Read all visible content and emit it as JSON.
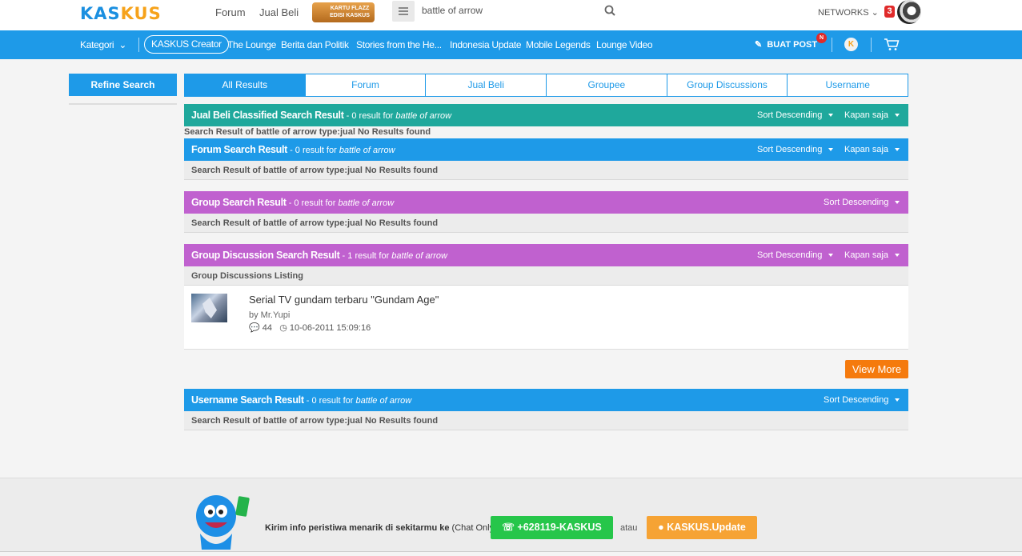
{
  "header": {
    "logo_part1": "KAS",
    "logo_part2": "KUS",
    "links": [
      "Forum",
      "Jual Beli"
    ],
    "promo_text": "KARTU FLAZZ EDISI KASKUS",
    "search_value": "battle of arrow",
    "networks_label": "NETWORKS",
    "notification_count": "3"
  },
  "navbar": {
    "kategori": "Kategori",
    "creator": "KASKUS Creator",
    "items": [
      "The Lounge",
      "Berita dan Politik",
      "Stories from the He...",
      "Indonesia Update",
      "Mobile Legends",
      "Lounge Video"
    ],
    "buat_post": "BUAT POST",
    "new_badge": "N"
  },
  "sidebar": {
    "refine_label": "Refine Search"
  },
  "tabs": [
    "All Results",
    "Forum",
    "Jual Beli",
    "Groupee",
    "Group Discussions",
    "Username"
  ],
  "sort_label": "Sort Descending",
  "time_label": "Kapan saja",
  "sections": {
    "jual_beli": {
      "title": "Jual Beli Classified Search Result",
      "count": " - 0 result for ",
      "query": "battle of arrow",
      "note": "Search Result of battle of arrow type:jual No Results found"
    },
    "forum": {
      "title": "Forum Search Result",
      "count": " - 0 result for ",
      "query": "battle of arrow",
      "note": "Search Result of battle of arrow type:jual No Results found"
    },
    "group": {
      "title": "Group Search Result",
      "count": " - 0 result for ",
      "query": "battle of arrow",
      "note": "Search Result of battle of arrow type:jual No Results found"
    },
    "group_discussion": {
      "title": "Group Discussion Search Result",
      "count": " - 1 result for ",
      "query": "battle of arrow",
      "listing": "Group Discussions Listing"
    },
    "username": {
      "title": "Username Search Result",
      "count": " - 0 result for ",
      "query": "battle of arrow",
      "note": "Search Result of battle of arrow type:jual No Results found"
    }
  },
  "result": {
    "title": "Serial TV gundam terbaru \"Gundam Age\"",
    "author": "by Mr.Yupi",
    "comments": "44",
    "date": "10-06-2011 15:09:16"
  },
  "view_more": "View More",
  "footer": {
    "kirim": "Kirim info peristiwa menarik di sekitarmu ke ",
    "chat_only": "(Chat Only)",
    "whatsapp": "+628119-KASKUS",
    "atau": "atau",
    "kaskus_update": "KASKUS.Update"
  },
  "colors": {
    "blue": "#1e9ae8",
    "teal": "#1fa89c",
    "purple": "#c061cf",
    "orange": "#f57a0d",
    "green": "#26c64a"
  }
}
